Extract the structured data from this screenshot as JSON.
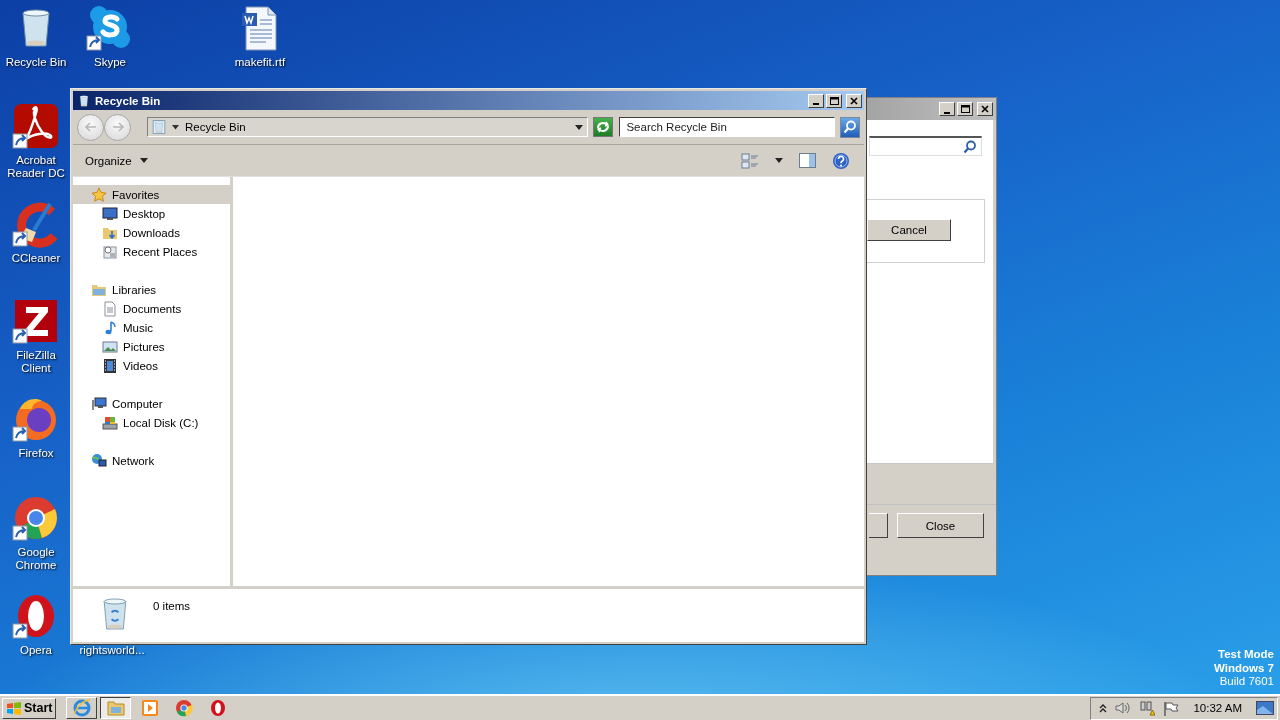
{
  "desktop_icons": [
    {
      "label": "Recycle Bin",
      "kind": "recycle-bin",
      "shortcut": false
    },
    {
      "label": "Skype",
      "kind": "skype",
      "shortcut": true
    },
    {
      "label": "makefit.rtf",
      "kind": "word-doc",
      "shortcut": false
    },
    {
      "label": "Acrobat Reader DC",
      "kind": "acrobat",
      "shortcut": true
    },
    {
      "label": "CCleaner",
      "kind": "ccleaner",
      "shortcut": true
    },
    {
      "label": "FileZilla Client",
      "kind": "filezilla",
      "shortcut": true
    },
    {
      "label": "Firefox",
      "kind": "firefox",
      "shortcut": true
    },
    {
      "label": "Google Chrome",
      "kind": "chrome",
      "shortcut": true
    },
    {
      "label": "Opera",
      "kind": "opera",
      "shortcut": true
    },
    {
      "label": "rightsworld...",
      "kind": "covered"
    }
  ],
  "background_window": {
    "buttons": [
      {
        "label": "Cancel",
        "kind": "group"
      },
      {
        "kind": "footer-stub"
      },
      {
        "label": "Close",
        "kind": "footer"
      }
    ]
  },
  "explorer": {
    "title": "Recycle Bin",
    "address": "Recycle Bin",
    "search": {
      "placeholder": "Search Recycle Bin"
    },
    "organize": "Organize",
    "nav": [
      {
        "label": "Favorites",
        "kind": "favorites",
        "selected": true,
        "children": [
          {
            "label": "Desktop",
            "kind": "desktop",
            "selected": false
          },
          {
            "label": "Downloads",
            "kind": "downloads",
            "selected": false
          },
          {
            "label": "Recent Places",
            "kind": "recent",
            "selected": false
          }
        ]
      },
      {
        "label": "Libraries",
        "kind": "libraries",
        "selected": false,
        "children": [
          {
            "label": "Documents",
            "kind": "documents",
            "selected": false
          },
          {
            "label": "Music",
            "kind": "music",
            "selected": false
          },
          {
            "label": "Pictures",
            "kind": "pictures",
            "selected": false
          },
          {
            "label": "Videos",
            "kind": "videos",
            "selected": false
          }
        ]
      },
      {
        "label": "Computer",
        "kind": "computer",
        "selected": false,
        "children": [
          {
            "label": "Local Disk (C:)",
            "kind": "disk",
            "selected": false
          }
        ]
      },
      {
        "label": "Network",
        "kind": "network",
        "selected": false
      }
    ],
    "details": {
      "count": "0 items"
    }
  },
  "taskbar": {
    "start": "Start",
    "apps": [
      {
        "kind": "ie",
        "running": true,
        "selected": false
      },
      {
        "kind": "explorer",
        "running": true,
        "selected": true
      },
      {
        "kind": "media",
        "running": false,
        "selected": false
      },
      {
        "kind": "chrome",
        "running": false,
        "selected": false
      },
      {
        "kind": "opera",
        "running": false,
        "selected": false
      }
    ],
    "clock": "10:32 AM"
  },
  "system_notice": [
    {
      "text": "Test Mode",
      "bold": true
    },
    {
      "text": "Windows 7",
      "bold": true
    },
    {
      "text": "Build 7601",
      "bold": false
    }
  ]
}
